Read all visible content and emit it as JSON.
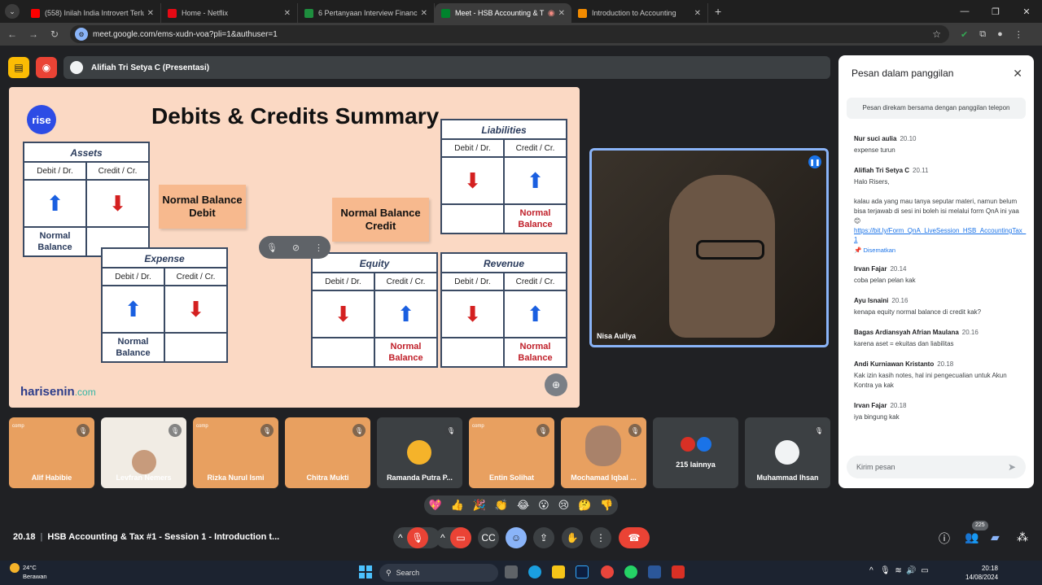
{
  "browser": {
    "tabs": [
      {
        "title": "(558) Inilah India Introvert Terlu",
        "color": "#ff0000",
        "active": false
      },
      {
        "title": "Home - Netflix",
        "color": "#e50914",
        "active": false
      },
      {
        "title": "6 Pertanyaan Interview Finance",
        "color": "#1e8e3e",
        "active": false
      },
      {
        "title": "Meet - HSB Accounting & T",
        "color": "#00832d",
        "active": true
      },
      {
        "title": "Introduction to Accounting",
        "color": "#f28b00",
        "active": false
      }
    ],
    "url": "meet.google.com/ems-xudn-voa?pli=1&authuser=1"
  },
  "presentation": {
    "presenter_label": "Alifiah Tri Setya C (Presentasi)"
  },
  "slide": {
    "logo": "rise",
    "title": "Debits & Credits Summary",
    "brand": "harisenin",
    "brand_suffix": ".com",
    "normal_balance_debit": "Normal Balance Debit",
    "normal_balance_credit": "Normal Balance Credit",
    "col_debit": "Debit / Dr.",
    "col_credit": "Credit / Cr.",
    "normal_balance": "Normal Balance",
    "accounts": {
      "assets": "Assets",
      "expense": "Expense",
      "liabilities": "Liabilities",
      "equity": "Equity",
      "revenue": "Revenue"
    }
  },
  "speaker": {
    "name": "Nisa Auliya"
  },
  "chat": {
    "title": "Pesan dalam panggilan",
    "note": "Pesan direkam bersama dengan panggilan telepon",
    "messages": [
      {
        "sender": "Nur suci aulia",
        "time": "20.10",
        "text": "expense turun"
      },
      {
        "sender": "Alifiah Tri Setya C",
        "time": "20.11",
        "text": "Halo Risers,\n\nkalau ada yang mau tanya seputar materi, namun belum bisa terjawab di sesi ini boleh isi melalui form QnA ini yaa 😊",
        "link": "https://bit.ly/Form_QnA_LiveSession_HSB_AccountingTax_1",
        "pinned": "Disematkan"
      },
      {
        "sender": "Irvan Fajar",
        "time": "20.14",
        "text": "coba pelan pelan kak"
      },
      {
        "sender": "Ayu Isnaini",
        "time": "20.16",
        "text": "kenapa equity normal balance di credit kak?"
      },
      {
        "sender": "Bagas Ardiansyah Afrian Maulana",
        "time": "20.16",
        "text": "karena aset = ekuitas dan liabilitas"
      },
      {
        "sender": "Andi Kurniawan Kristanto",
        "time": "20.18",
        "text": "Kak izin kasih notes, hal ini pengecualian untuk Akun Kontra ya kak"
      },
      {
        "sender": "Irvan Fajar",
        "time": "20.18",
        "text": "iya bingung kak"
      }
    ],
    "input_placeholder": "Kirim pesan"
  },
  "participants": [
    {
      "name": "Alif Habibie"
    },
    {
      "name": "Levfran Nemers"
    },
    {
      "name": "Rizka Nurul Ismi"
    },
    {
      "name": "Chitra Mukti"
    },
    {
      "name": "Ramanda Putra P..."
    },
    {
      "name": "Entin Solihat"
    },
    {
      "name": "Mochamad Iqbal ..."
    },
    {
      "name": "215 lainnya"
    },
    {
      "name": "Muhammad Ihsan"
    }
  ],
  "reactions": [
    "💖",
    "👍",
    "🎉",
    "👏",
    "😂",
    "😮",
    "😢",
    "🤔",
    "👎"
  ],
  "meeting": {
    "time": "20.18",
    "title": "HSB Accounting & Tax #1 - Session 1 - Introduction t...",
    "participant_count": "225"
  },
  "taskbar": {
    "temperature": "24°C",
    "weather": "Berawan",
    "search": "Search",
    "time": "20:18",
    "date": "14/08/2024"
  }
}
